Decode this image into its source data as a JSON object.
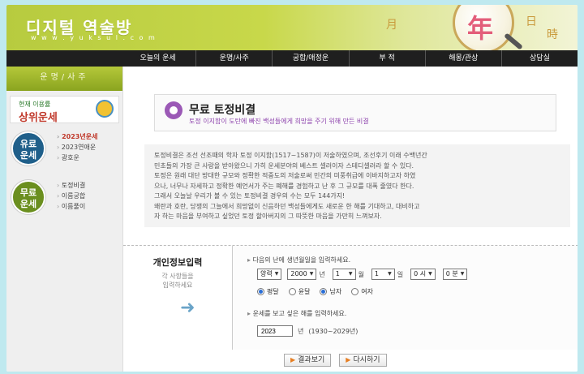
{
  "header": {
    "logo": "디지털 역술방",
    "url": "w w w . y u k s u l . c o m",
    "hanja_month": "月",
    "hanja_year": "年",
    "hanja_day": "日",
    "hanja_time": "時"
  },
  "nav": [
    "오늘의 운세",
    "운명/사주",
    "궁합/애정운",
    "부 적",
    "해몽/관상",
    "상담실"
  ],
  "sidebar": {
    "heading": "운명/사주",
    "banner_small": "현재 이용률",
    "banner_big": "상위운세",
    "sections": [
      {
        "badge": "유료\n운세",
        "color": "#1f5f8a",
        "links": [
          "2023년운세",
          "2023연애운",
          "광호운"
        ],
        "hot_index": 0
      },
      {
        "badge": "무료\n운세",
        "color": "#6b8f1f",
        "links": [
          "토정비결",
          "이름궁합",
          "이름풀이"
        ],
        "hot_index": -1
      }
    ]
  },
  "content": {
    "title": "무료 토정비결",
    "subtitle": "토정 이지함이 도탄에 빠진 백성들에게 희망을 주기 위해 만든 비결",
    "intro": [
      "토정비결은 조선 선조때의 학자 토정 이지함(1517~1587)이 저술하였으며, 조선후기 이래 수백년간",
      "민초들의 가장 큰 사랑을 받아왔으니 가히 운세분야의 베스트 셀러이자 스테디셀러라 할 수 있다.",
      "토정은 원래 대단 방대한 규모와 정확한 적중도의 저술로써 민간의 미풍취급에 이바지하고자 하였",
      "으나, 너무나 자세하고 정확한 예언서가 주는 폐해를 경험하고 난 후 그 규모를 대폭 줄였다 한다.",
      "그래서 오늘날 우리가 볼 수 있는 토정비결 경우의 수는 모두 144가지!",
      "왜란과 호란, 당쟁의 그늘에서 희망없이 신음하던 백성들에게도 새로운 한 해를 기대하고, 대비하고",
      "자 하는 마음을 부여하고 싶었던 토정 할아버지의 그 따뜻한 마음을 가만히 느껴보자."
    ]
  },
  "form": {
    "title": "개인정보입력",
    "note": "각 사항들을\n입력하세요",
    "q1": "다음의 난에 생년월일을 입력하세요.",
    "calendar": "양력",
    "year": "2000",
    "year_unit": "년",
    "month": "1",
    "month_unit": "월",
    "day": "1",
    "day_unit": "일",
    "hour": "0 시",
    "minute": "0 분",
    "radio_pyeong": "평달",
    "radio_yun": "윤달",
    "radio_male": "남자",
    "radio_female": "여자",
    "q2": "운세를 보고 싶은 해를 입력하세요.",
    "target_year": "2023",
    "target_unit": "년",
    "range": "(1930~2029년)"
  },
  "buttons": {
    "submit": "결과보기",
    "reset": "다시하기"
  }
}
